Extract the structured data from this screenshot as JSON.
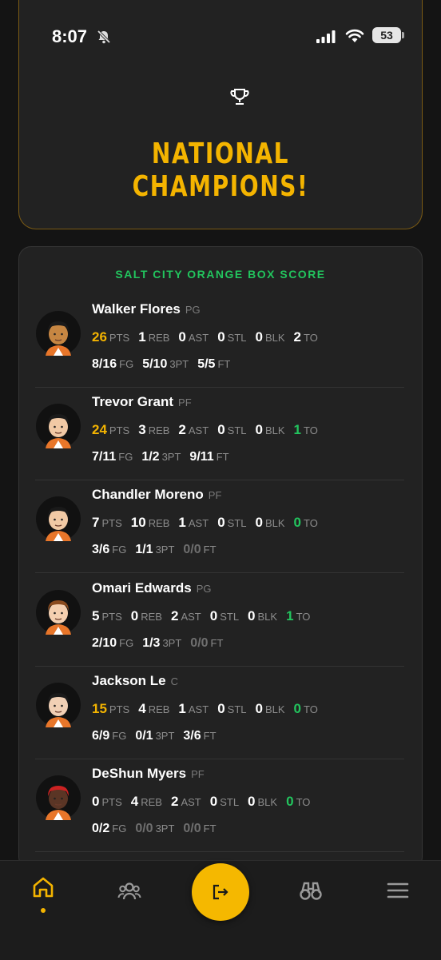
{
  "status_bar": {
    "time": "8:07",
    "battery": "53"
  },
  "hero": {
    "title": "NATIONAL CHAMPIONS!",
    "icon": "trophy-icon"
  },
  "box_score": {
    "title": "SALT CITY ORANGE BOX SCORE",
    "players": [
      {
        "name": "Walker Flores",
        "pos": "PG",
        "pts": "26",
        "reb": "1",
        "ast": "0",
        "stl": "0",
        "blk": "0",
        "to": "2",
        "fg": "8/16",
        "tpt": "5/10",
        "ft": "5/5"
      },
      {
        "name": "Trevor Grant",
        "pos": "PF",
        "pts": "24",
        "reb": "3",
        "ast": "2",
        "stl": "0",
        "blk": "0",
        "to": "1",
        "fg": "7/11",
        "tpt": "1/2",
        "ft": "9/11"
      },
      {
        "name": "Chandler Moreno",
        "pos": "PF",
        "pts": "7",
        "reb": "10",
        "ast": "1",
        "stl": "0",
        "blk": "0",
        "to": "0",
        "fg": "3/6",
        "tpt": "1/1",
        "ft": "0/0"
      },
      {
        "name": "Omari Edwards",
        "pos": "PG",
        "pts": "5",
        "reb": "0",
        "ast": "2",
        "stl": "0",
        "blk": "0",
        "to": "1",
        "fg": "2/10",
        "tpt": "1/3",
        "ft": "0/0"
      },
      {
        "name": "Jackson Le",
        "pos": "C",
        "pts": "15",
        "reb": "4",
        "ast": "1",
        "stl": "0",
        "blk": "0",
        "to": "0",
        "fg": "6/9",
        "tpt": "0/1",
        "ft": "3/6"
      },
      {
        "name": "DeShun Myers",
        "pos": "PF",
        "pts": "0",
        "reb": "4",
        "ast": "2",
        "stl": "0",
        "blk": "0",
        "to": "0",
        "fg": "0/2",
        "tpt": "0/0",
        "ft": "0/0"
      }
    ],
    "labels": {
      "pts": "PTS",
      "reb": "REB",
      "ast": "AST",
      "stl": "STL",
      "blk": "BLK",
      "to": "TO",
      "fg": "FG",
      "tpt": "3PT",
      "ft": "FT"
    }
  },
  "nav": {
    "items": [
      "home-icon",
      "team-icon",
      "exit-icon",
      "binoculars-icon",
      "menu-icon"
    ],
    "active": "home-icon"
  },
  "colors": {
    "accent": "#f4b400",
    "green": "#22c55e",
    "background": "#141414",
    "card": "#222222"
  }
}
